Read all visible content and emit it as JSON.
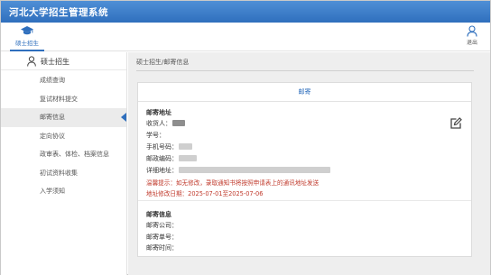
{
  "app": {
    "title": "河北大学招生管理系统"
  },
  "topnav": {
    "active_tab": {
      "label": "硕士招生",
      "icon": "graduation-cap-icon"
    },
    "logout": {
      "label": "退出",
      "icon": "user-icon"
    }
  },
  "sidebar": {
    "header": {
      "label": "硕士招生",
      "icon": "user-icon"
    },
    "items": [
      {
        "label": "成绩查询"
      },
      {
        "label": "复试材料提交"
      },
      {
        "label": "邮寄信息",
        "active": true
      },
      {
        "label": "定向协议"
      },
      {
        "label": "政审表、体检、档案信息"
      },
      {
        "label": "初试资料收集"
      },
      {
        "label": "入学须知"
      }
    ]
  },
  "main": {
    "breadcrumb": "硕士招生/邮寄信息",
    "card": {
      "tab": "邮寄",
      "mailing_address": {
        "title": "邮寄地址",
        "recipient_label": "收货人：",
        "student_id_label": "学号：",
        "phone_label": "手机号码：",
        "postcode_label": "邮政编码：",
        "address_label": "详细地址：",
        "notice": "温馨提示：如无修改，录取通知书将按照申请表上的通讯地址发送",
        "modify_period": "地址修改日期：2025-07-01至2025-07-06",
        "edit_icon": "edit-icon"
      },
      "mailing_info": {
        "title": "邮寄信息",
        "company_label": "邮寄公司：",
        "tracking_label": "邮寄单号：",
        "time_label": "邮寄时间："
      }
    }
  },
  "colors": {
    "primary": "#2f6fbd",
    "notice": "#c0392b",
    "header_bg": "#3a7cc8"
  }
}
